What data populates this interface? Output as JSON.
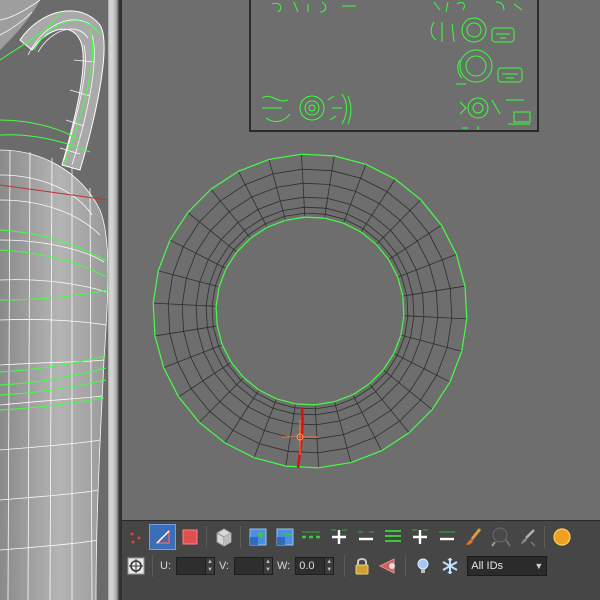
{
  "viewport": {
    "background": "#6e6e6e",
    "wire_color": "#44ff44",
    "mesh_color": "#2e2e2e",
    "seam_color": "#e01010",
    "gizmo_color": "#ff7a3a"
  },
  "toolbar": {
    "row1_buttons": [
      {
        "name": "vertex-mode-button",
        "icon": "vertex-dots-icon"
      },
      {
        "name": "edge-mode-button",
        "icon": "edge-icon",
        "active": true
      },
      {
        "name": "polygon-mode-button",
        "icon": "red-square-icon"
      },
      {
        "name": "select-element-button",
        "icon": "cube-icon"
      },
      {
        "name": "expand-selection-button",
        "icon": "grow-selection-icon"
      },
      {
        "name": "shrink-selection-button",
        "icon": "shrink-selection-icon"
      },
      {
        "name": "loop-select-button",
        "icon": "loop-icon"
      },
      {
        "name": "ring-grow-button",
        "icon": "plus-icon"
      },
      {
        "name": "ring-shrink-button",
        "icon": "minus-icon"
      },
      {
        "name": "loop-grow-button",
        "icon": "plus-lines-icon"
      },
      {
        "name": "loop-shrink-button",
        "icon": "minus-lines-icon"
      },
      {
        "name": "paint-select-button",
        "icon": "brush-icon"
      },
      {
        "name": "paint-size-up-button",
        "icon": "paint-large-icon"
      },
      {
        "name": "paint-size-down-button",
        "icon": "paint-small-icon"
      },
      {
        "name": "render-button",
        "icon": "orange-circle-icon"
      }
    ],
    "u_label": "U:",
    "v_label": "V:",
    "w_label": "W:",
    "u_value": "",
    "v_value": "",
    "w_value": "0.0",
    "id_select": "All IDs",
    "colors": {
      "panel": "#464646",
      "active": "#3a6fb8",
      "accent_green": "#3cc83c",
      "accent_blue": "#4a8fe0",
      "accent_red": "#e05050"
    }
  }
}
